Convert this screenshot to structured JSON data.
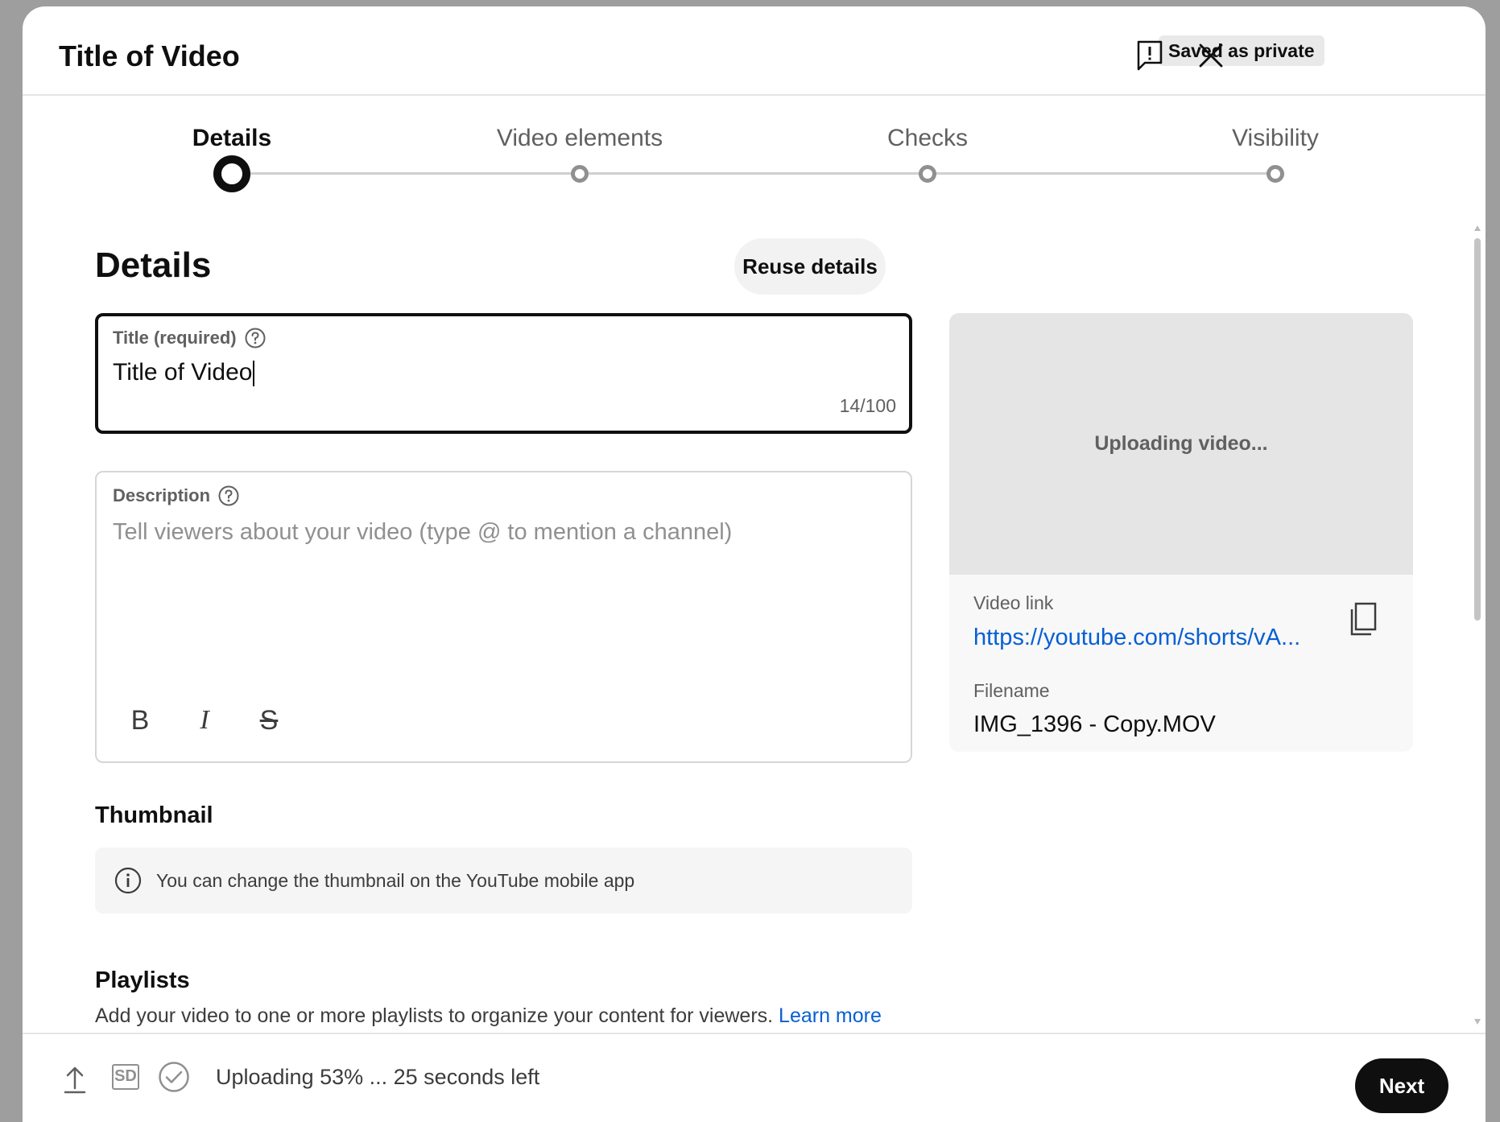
{
  "header": {
    "title": "Title of Video",
    "saved_badge": "Saved as private",
    "feedback_icon": "feedback-icon",
    "close_icon": "close-icon"
  },
  "stepper": {
    "steps": [
      {
        "label": "Details",
        "active": true
      },
      {
        "label": "Video elements",
        "active": false
      },
      {
        "label": "Checks",
        "active": false
      },
      {
        "label": "Visibility",
        "active": false
      }
    ]
  },
  "details": {
    "heading": "Details",
    "reuse_button": "Reuse details",
    "title_field": {
      "label": "Title (required)",
      "value": "Title of Video",
      "counter": "14/100"
    },
    "description_field": {
      "label": "Description",
      "placeholder": "Tell viewers about your video (type @ to mention a channel)",
      "value": ""
    },
    "format_buttons": [
      {
        "name": "bold",
        "glyph": "B"
      },
      {
        "name": "italic",
        "glyph": "I"
      },
      {
        "name": "strikethrough",
        "glyph": "S"
      }
    ],
    "thumbnail": {
      "heading": "Thumbnail",
      "info": "You can change the thumbnail on the YouTube mobile app"
    },
    "playlists": {
      "heading": "Playlists",
      "text": "Add your video to one or more playlists to organize your content for viewers.",
      "learn_more": "Learn more"
    }
  },
  "side_panel": {
    "preview_text": "Uploading video...",
    "video_link_label": "Video link",
    "video_link": "https://youtube.com/shorts/vA...",
    "filename_label": "Filename",
    "filename": "IMG_1396 - Copy.MOV"
  },
  "footer": {
    "sd_badge": "SD",
    "status": "Uploading 53% ... 25 seconds left",
    "upload_progress": 0.53,
    "next_button": "Next"
  },
  "colors": {
    "link": "#065fd4",
    "primary": "#0f0f0f",
    "muted": "#606060"
  }
}
